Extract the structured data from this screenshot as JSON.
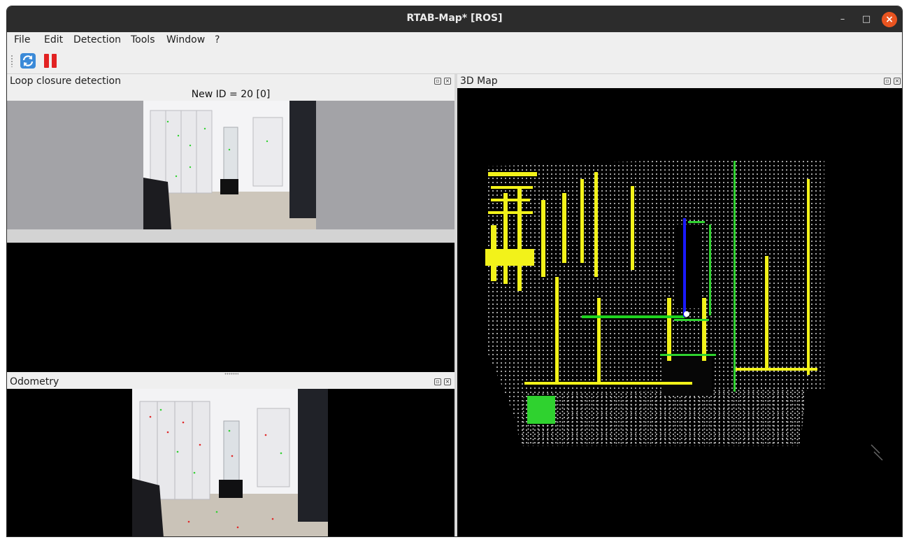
{
  "window": {
    "title": "RTAB-Map* [ROS]",
    "controls": {
      "minimize": "–",
      "maximize": "□",
      "close": "×"
    }
  },
  "menu": [
    "File",
    "Edit",
    "Detection",
    "Tools",
    "Window",
    "?"
  ],
  "toolbar": {
    "buttons": [
      {
        "name": "refresh",
        "icon": "refresh-icon",
        "color": "#2f7fd0"
      },
      {
        "name": "pause",
        "icon": "pause-icon",
        "color": "#e02020"
      }
    ]
  },
  "loop_closure": {
    "title": "Loop closure detection",
    "new_id_label": "New ID = 20 [0]"
  },
  "odometry": {
    "title": "Odometry"
  },
  "map3d": {
    "title": "3D Map",
    "axes": {
      "x_color": "#1fd41f",
      "z_color": "#1a1aff"
    }
  },
  "colors": {
    "titlebar": "#2c2c2c",
    "close_button": "#e95420",
    "point_gray": "#d7d7d7",
    "point_yellow": "#f2f21a",
    "point_green": "#2fd22f"
  }
}
